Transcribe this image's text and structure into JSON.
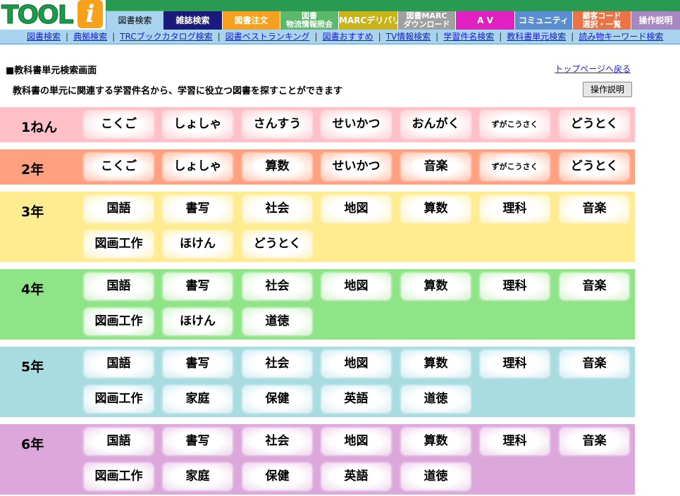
{
  "header": {
    "logo_text": "TOOL",
    "logo_i": "i",
    "tabs": [
      {
        "label": "図書検索",
        "bg": "#a8d4ef",
        "fg": "#000000"
      },
      {
        "label": "雑誌検索",
        "bg": "#1a1a7a",
        "fg": "#ffffff"
      },
      {
        "label": "図書注文",
        "bg": "#f5a020",
        "fg": "#ffffff"
      },
      {
        "label": "図書物流情報照会",
        "line1": "図書",
        "line2": "物流情報照会",
        "bg": "#5cb86a",
        "fg": "#ffffff"
      },
      {
        "label": "MARCデリバリ",
        "bg": "#c8b418",
        "fg": "#ffffff"
      },
      {
        "label": "図書MARCダウンロード",
        "line1": "図書MARC",
        "line2": "ダウンロード",
        "bg": "#a0a0a0",
        "fg": "#ffffff"
      },
      {
        "label": "A V",
        "bg": "#e020c0",
        "fg": "#ffffff"
      },
      {
        "label": "コミュニティ",
        "bg": "#5a8ed0",
        "fg": "#ffffff"
      },
      {
        "label": "顧客コード選択・一覧",
        "line1": "顧客コード",
        "line2": "選択・一覧",
        "bg": "#ea7448",
        "fg": "#ffffff"
      },
      {
        "label": "操作説明",
        "bg": "#a888c0",
        "fg": "#ffffff"
      }
    ]
  },
  "subnav": [
    "図書検索",
    "典拠検索",
    "TRCブックカタログ検索",
    "図書ベストランキング",
    "図書おすすめ",
    "TV情報検索",
    "学習件名検索",
    "教科書単元検索",
    "読み物キーワード検索"
  ],
  "page": {
    "title": "■教科書単元検索画面",
    "back_link": "トップページへ戻る",
    "description": "教科書の単元に関連する学習件名から、学習に役立つ図書を探すことができます",
    "help_button": "操作説明"
  },
  "grades": [
    {
      "label": "1ねん",
      "bg": "#ffc0c8",
      "tint": "pink",
      "subjects": [
        "こくご",
        "しょしゃ",
        "さんすう",
        "せいかつ",
        "おんがく",
        "ずがこうさく",
        "どうとく"
      ]
    },
    {
      "label": "2年",
      "bg": "#ffa080",
      "tint": "orange",
      "subjects": [
        "こくご",
        "しょしゃ",
        "算数",
        "せいかつ",
        "音楽",
        "ずがこうさく",
        "どうとく"
      ]
    },
    {
      "label": "3年",
      "bg": "#ffeb90",
      "tint": "yellow",
      "subjects": [
        "国語",
        "書写",
        "社会",
        "地図",
        "算数",
        "理科",
        "音楽",
        "図画工作",
        "ほけん",
        "どうとく"
      ]
    },
    {
      "label": "4年",
      "bg": "#90e488",
      "tint": "green",
      "subjects": [
        "国語",
        "書写",
        "社会",
        "地図",
        "算数",
        "理科",
        "音楽",
        "図画工作",
        "ほけん",
        "道徳"
      ]
    },
    {
      "label": "5年",
      "bg": "#a8dce0",
      "tint": "blue",
      "subjects": [
        "国語",
        "書写",
        "社会",
        "地図",
        "算数",
        "理科",
        "音楽",
        "図画工作",
        "家庭",
        "保健",
        "英語",
        "道徳"
      ]
    },
    {
      "label": "6年",
      "bg": "#dca8dc",
      "tint": "purple",
      "subjects": [
        "国語",
        "書写",
        "社会",
        "地図",
        "算数",
        "理科",
        "音楽",
        "図画工作",
        "家庭",
        "保健",
        "英語",
        "道徳"
      ]
    }
  ]
}
